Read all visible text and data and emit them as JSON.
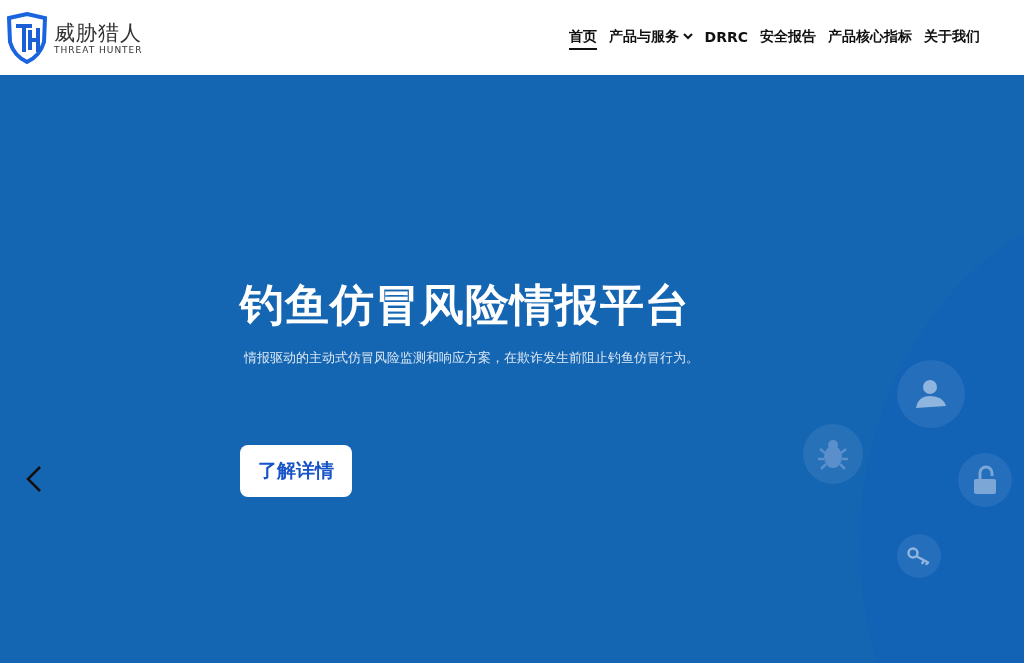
{
  "logo": {
    "name": "威胁猎人",
    "subtitle": "THREAT HUNTER"
  },
  "nav": [
    {
      "label": "首页",
      "selected": true,
      "dropdown": false
    },
    {
      "label": "产品与服务",
      "selected": false,
      "dropdown": true
    },
    {
      "label": "DRRC",
      "selected": false,
      "dropdown": false
    },
    {
      "label": "安全报告",
      "selected": false,
      "dropdown": false
    },
    {
      "label": "产品核心指标",
      "selected": false,
      "dropdown": false
    },
    {
      "label": "关于我们",
      "selected": false,
      "dropdown": false
    }
  ],
  "hero": {
    "title": "钓鱼仿冒风险情报平台",
    "description": "情报驱动的主动式仿冒风险监测和响应方案，在欺诈发生前阻止钓鱼仿冒行为。",
    "button": "了解详情"
  }
}
